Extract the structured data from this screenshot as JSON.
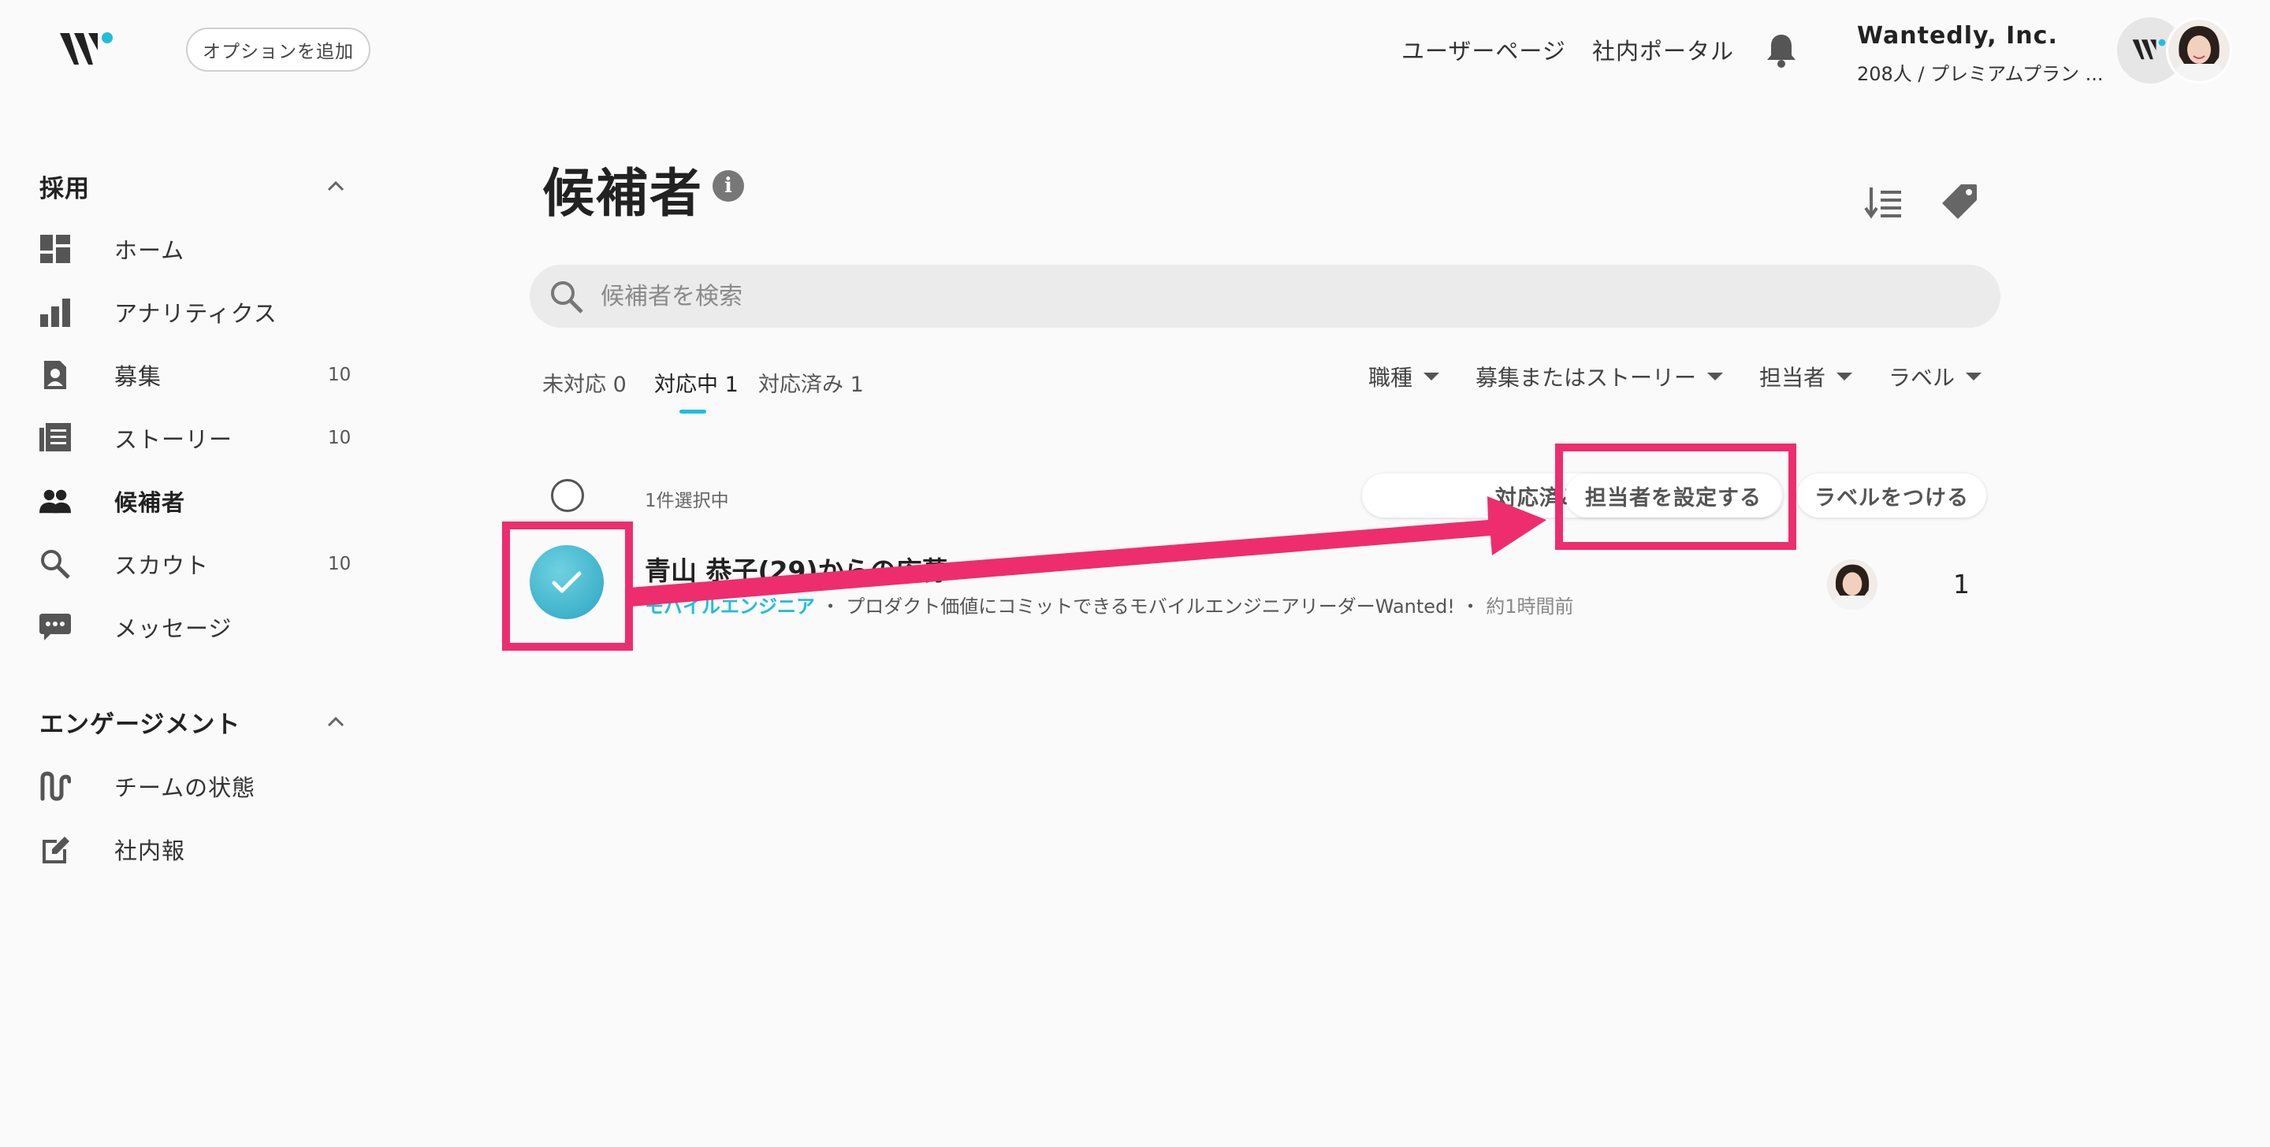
{
  "header": {
    "option_button": "オプションを追加",
    "nav": [
      "ユーザーページ",
      "社内ポータル"
    ],
    "company_name": "Wantedly, Inc.",
    "company_sub": "208人 / プレミアムプラン ...",
    "icons": [
      "wantedly-logo",
      "bell-icon"
    ]
  },
  "sidebar": {
    "sections": [
      {
        "title": "採用",
        "items": [
          {
            "label": "ホーム",
            "count": "",
            "icon": "dashboard-icon"
          },
          {
            "label": "アナリティクス",
            "count": "",
            "icon": "bar-chart-icon"
          },
          {
            "label": "募集",
            "count": "10",
            "icon": "badge-icon"
          },
          {
            "label": "ストーリー",
            "count": "10",
            "icon": "article-icon"
          },
          {
            "label": "候補者",
            "count": "",
            "icon": "people-icon"
          },
          {
            "label": "スカウト",
            "count": "10",
            "icon": "search-icon"
          },
          {
            "label": "メッセージ",
            "count": "",
            "icon": "chat-icon"
          }
        ]
      },
      {
        "title": "エンゲージメント",
        "items": [
          {
            "label": "チームの状態",
            "count": "",
            "icon": "wave-icon"
          },
          {
            "label": "社内報",
            "count": "",
            "icon": "edit-icon"
          }
        ]
      }
    ]
  },
  "main": {
    "title": "候補者",
    "search_placeholder": "候補者を検索",
    "tabs": [
      {
        "label": "未対応 0",
        "active": false
      },
      {
        "label": "対応中 1",
        "active": true
      },
      {
        "label": "対応済み 1",
        "active": false
      }
    ],
    "filters": [
      "職種",
      "募集またはストーリー",
      "担当者",
      "ラベル"
    ],
    "selection_count": "1件選択中",
    "actions": [
      "対応済みにする",
      "担当者を設定する",
      "ラベルをつける"
    ],
    "candidate": {
      "name": "青山 恭子(29)からの応募",
      "job": "モバイルエンジニア",
      "separator": " ・ ",
      "story": "プロダクト価値にコミットできるモバイルエンジニアリーダーWanted!",
      "time": "約1時間前",
      "messages": "1"
    }
  },
  "colors": {
    "accent": "#21bddb",
    "highlight": "#ee2d6e",
    "background": "#fafafa"
  }
}
